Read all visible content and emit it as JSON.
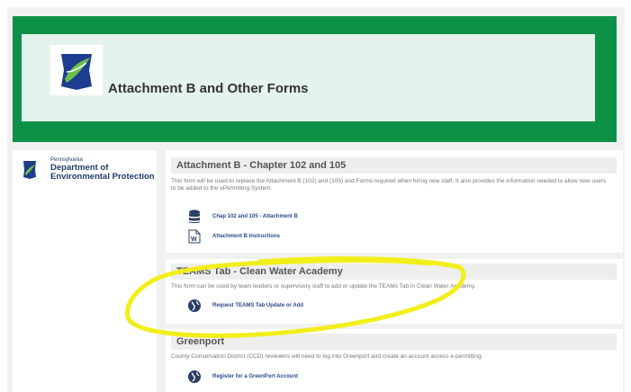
{
  "header": {
    "title": "Attachment B and Other Forms"
  },
  "sidebar": {
    "state": "Pennsylvania",
    "dept_line1": "Department of",
    "dept_line2": "Environmental Protection"
  },
  "sections": [
    {
      "title": "Attachment B - Chapter 102 and 105",
      "description": "This form will be used to replace the Attachment B (102) and (105) and Forms required when hiring new staff. It also provides the information needed to allow new users to be added to the ePermitting System.",
      "links": [
        {
          "label": "Chap 102 and 105 - Attachment B",
          "icon": "database-icon"
        },
        {
          "label": "Attachment B Instructions",
          "icon": "word-document-icon"
        }
      ]
    },
    {
      "title": "TEAMS Tab - Clean Water Academy",
      "description": "This form can be used by team leaders or supervisory staff to add or update the TEAMs Tab in Clean Water Academy.",
      "links": [
        {
          "label": "Request TEAMS Tab Update or Add",
          "icon": "globe-icon"
        }
      ]
    },
    {
      "title": "Greenport",
      "description": "County Conservation District (CCD) reviewers will need to log into Greenport and create an account access e-permitting.",
      "links": [
        {
          "label": "Register for a GreenPort Account",
          "icon": "globe-icon"
        }
      ]
    }
  ],
  "colors": {
    "header_green": "#0d9146",
    "header_inner": "#e4f4ec",
    "link_blue": "#2a4a8a",
    "highlight_yellow": "#f2ee1a"
  }
}
